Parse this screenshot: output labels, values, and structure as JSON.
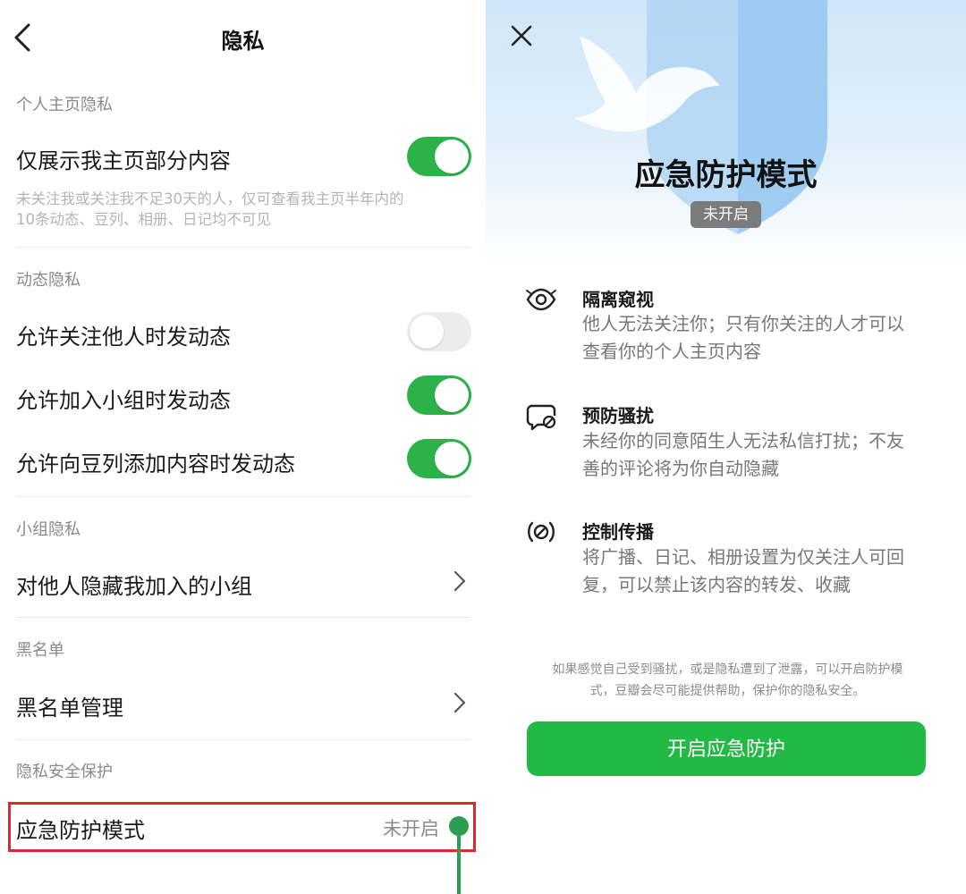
{
  "left": {
    "nav": {
      "title": "隐私"
    },
    "sections": {
      "profile": {
        "label": "个人主页隐私",
        "rows": [
          {
            "label": "仅展示我主页部分内容",
            "toggle": "on",
            "desc_line1": "未关注我或关注我不足30天的人，仅可查看我主页半年内的",
            "desc_line2": "10条动态、豆列、相册、日记均不可见"
          }
        ]
      },
      "activity": {
        "label": "动态隐私",
        "rows": [
          {
            "label": "允许关注他人时发动态",
            "toggle": "off"
          },
          {
            "label": "允许加入小组时发动态",
            "toggle": "on"
          },
          {
            "label": "允许向豆列添加内容时发动态",
            "toggle": "on"
          }
        ]
      },
      "group": {
        "label": "小组隐私",
        "rows": [
          {
            "label": "对他人隐藏我加入的小组"
          }
        ]
      },
      "blacklist": {
        "label": "黑名单",
        "rows": [
          {
            "label": "黑名单管理"
          }
        ]
      },
      "security": {
        "label": "隐私安全保护",
        "rows": [
          {
            "label": "应急防护模式",
            "value": "未开启"
          }
        ]
      }
    }
  },
  "right": {
    "title": "应急防护模式",
    "status": "未开启",
    "features": [
      {
        "icon": "eye-icon",
        "title": "隔离窥视",
        "line1": "他人无法关注你；只有你关注的人才可以",
        "line2": "查看你的个人主页内容"
      },
      {
        "icon": "chat-block-icon",
        "title": "预防骚扰",
        "line1": "未经你的同意陌生人无法私信打扰；不友",
        "line2": "善的评论将为你自动隐藏"
      },
      {
        "icon": "broadcast-block-icon",
        "title": "控制传播",
        "line1": "将广播、日记、相册设置为仅关注人可回",
        "line2": "复，可以禁止该内容的转发、收藏"
      }
    ],
    "footnote_line1": "如果感觉自己受到骚扰，或是隐私遭到了泄露，可以开启防护模",
    "footnote_line2": "式，豆瓣会尽可能提供帮助，保护你的隐私安全。",
    "cta": "开启应急防护"
  },
  "colors": {
    "toggle_on": "#2bb34a",
    "toggle_off": "#ececec",
    "cta": "#22b944",
    "highlight": "#d92b2b",
    "callout": "#2c9e53",
    "badge": "#7b7b7b"
  }
}
